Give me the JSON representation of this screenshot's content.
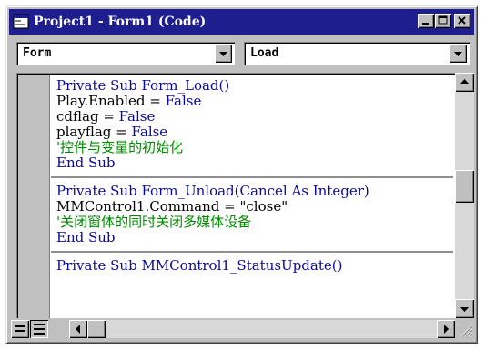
{
  "window": {
    "title": "Project1 - Form1 (Code)"
  },
  "object_combo": {
    "value": "Form"
  },
  "procedure_combo": {
    "value": "Load"
  },
  "code": {
    "procedures": [
      {
        "lines": [
          [
            {
              "t": "Private Sub ",
              "c": "kw"
            },
            {
              "t": "Form_Load()",
              "c": "kw"
            }
          ],
          [
            {
              "t": "Play.Enabled = ",
              "c": "tx"
            },
            {
              "t": "False",
              "c": "kw"
            }
          ],
          [
            {
              "t": "cdflag = ",
              "c": "tx"
            },
            {
              "t": "False",
              "c": "kw"
            }
          ],
          [
            {
              "t": "playflag = ",
              "c": "tx"
            },
            {
              "t": "False",
              "c": "kw"
            }
          ],
          [
            {
              "t": "'控件与变量的初始化",
              "c": "cm"
            }
          ],
          [
            {
              "t": "End Sub",
              "c": "kw"
            }
          ]
        ]
      },
      {
        "lines": [
          [
            {
              "t": "Private Sub ",
              "c": "kw"
            },
            {
              "t": "Form_Unload(Cancel ",
              "c": "kw"
            },
            {
              "t": "As Integer)",
              "c": "kw"
            }
          ],
          [
            {
              "t": "MMControl1.Command = \"close\"",
              "c": "tx"
            }
          ],
          [
            {
              "t": "'关闭窗体的同时关闭多媒体设备",
              "c": "cm"
            }
          ],
          [
            {
              "t": "End Sub",
              "c": "kw"
            }
          ]
        ]
      },
      {
        "lines": [
          [
            {
              "t": "Private Sub ",
              "c": "kw"
            },
            {
              "t": "MMControl1_StatusUpdate()",
              "c": "kw"
            }
          ]
        ]
      }
    ]
  },
  "colors": {
    "keyword": "#0a0a9a",
    "text": "#000000",
    "comment": "#008a00",
    "titlebar": "#1e1e8e",
    "chrome": "#c0c0c0"
  },
  "icons": [
    "form-app-icon",
    "minimize-icon",
    "maximize-icon",
    "close-icon",
    "chevron-down-icon",
    "scroll-up-icon",
    "scroll-down-icon",
    "scroll-left-icon",
    "scroll-right-icon",
    "procedure-view-icon",
    "full-module-view-icon",
    "resize-grip-icon"
  ],
  "scroll": {
    "vertical_position": 0.45
  }
}
